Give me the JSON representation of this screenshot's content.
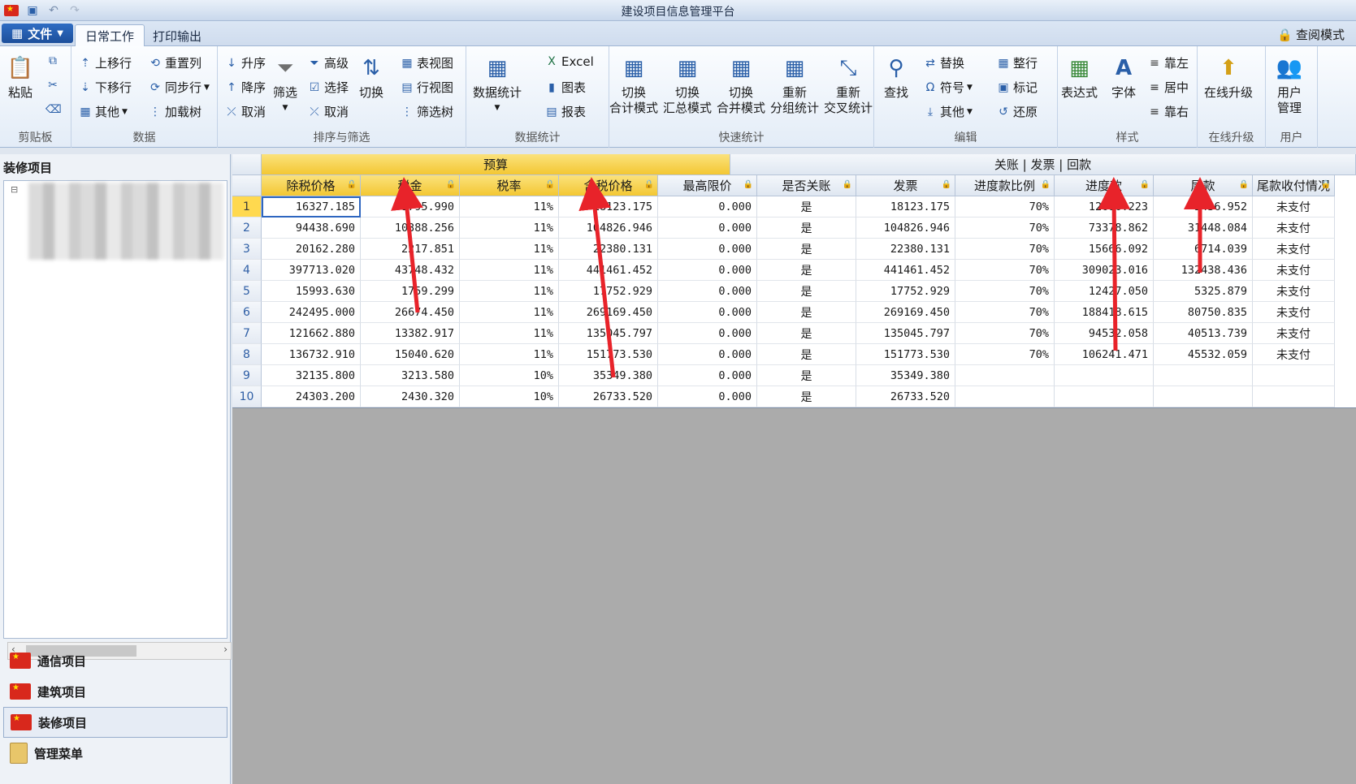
{
  "window": {
    "title": "建设项目信息管理平台",
    "view_mode": "查阅模式"
  },
  "tabs": {
    "file": "文件",
    "items": [
      "日常工作",
      "打印输出"
    ],
    "active": "日常工作"
  },
  "ribbon": {
    "clipboard": {
      "label": "剪贴板",
      "paste": "粘贴"
    },
    "data": {
      "label": "数据",
      "move_up": "上移行",
      "move_down": "下移行",
      "other": "其他",
      "reset_cols": "重置列",
      "sync_rows": "同步行",
      "load_tree": "加载树"
    },
    "sort_filter": {
      "label": "排序与筛选",
      "asc": "升序",
      "desc": "降序",
      "cancel_sort": "取消",
      "filter": "筛选",
      "advanced": "高级",
      "select": "选择",
      "cancel_filter": "取消",
      "switch": "切换",
      "table_view": "表视图",
      "row_view": "行视图",
      "filter_tree": "筛选树"
    },
    "stats": {
      "label": "数据统计",
      "data_stats": "数据统计",
      "excel": "Excel",
      "chart": "图表",
      "report": "报表"
    },
    "quick_stats": {
      "label": "快速统计",
      "b1_line1": "切换",
      "b1_line2": "合计模式",
      "b2_line1": "切换",
      "b2_line2": "汇总模式",
      "b3_line1": "切换",
      "b3_line2": "合并模式",
      "b4_line1": "重新",
      "b4_line2": "分组统计",
      "b5_line1": "重新",
      "b5_line2": "交叉统计"
    },
    "edit": {
      "label": "编辑",
      "find": "查找",
      "replace": "替换",
      "symbol": "符号",
      "other": "其他",
      "tidy": "整行",
      "mark": "标记",
      "restore": "还原"
    },
    "style": {
      "label": "样式",
      "expression": "表达式",
      "font": "字体",
      "left": "靠左",
      "center": "居中",
      "right": "靠右"
    },
    "upgrade": {
      "label": "在线升级",
      "button": "在线升级"
    },
    "user": {
      "label": "用户",
      "line1": "用户",
      "line2": "管理"
    }
  },
  "left_panel": {
    "title": "装修项目",
    "nav": [
      "通信项目",
      "建筑项目",
      "装修项目",
      "管理菜单"
    ],
    "active_nav": "装修项目"
  },
  "grid": {
    "band_headers": [
      "预算",
      "关账 | 发票 | 回款"
    ],
    "columns": [
      "除税价格",
      "税金",
      "税率",
      "含税价格",
      "最高限价",
      "是否关账",
      "发票",
      "进度款比例",
      "进度款",
      "尾款",
      "尾款收付情况"
    ],
    "rows": [
      [
        "16327.185",
        "1795.990",
        "11%",
        "18123.175",
        "0.000",
        "是",
        "18123.175",
        "70%",
        "12686.223",
        "5436.952",
        "未支付"
      ],
      [
        "94438.690",
        "10388.256",
        "11%",
        "104826.946",
        "0.000",
        "是",
        "104826.946",
        "70%",
        "73378.862",
        "31448.084",
        "未支付"
      ],
      [
        "20162.280",
        "2217.851",
        "11%",
        "22380.131",
        "0.000",
        "是",
        "22380.131",
        "70%",
        "15666.092",
        "6714.039",
        "未支付"
      ],
      [
        "397713.020",
        "43748.432",
        "11%",
        "441461.452",
        "0.000",
        "是",
        "441461.452",
        "70%",
        "309023.016",
        "132438.436",
        "未支付"
      ],
      [
        "15993.630",
        "1759.299",
        "11%",
        "17752.929",
        "0.000",
        "是",
        "17752.929",
        "70%",
        "12427.050",
        "5325.879",
        "未支付"
      ],
      [
        "242495.000",
        "26674.450",
        "11%",
        "269169.450",
        "0.000",
        "是",
        "269169.450",
        "70%",
        "188418.615",
        "80750.835",
        "未支付"
      ],
      [
        "121662.880",
        "13382.917",
        "11%",
        "135045.797",
        "0.000",
        "是",
        "135045.797",
        "70%",
        "94532.058",
        "40513.739",
        "未支付"
      ],
      [
        "136732.910",
        "15040.620",
        "11%",
        "151773.530",
        "0.000",
        "是",
        "151773.530",
        "70%",
        "106241.471",
        "45532.059",
        "未支付"
      ],
      [
        "32135.800",
        "3213.580",
        "10%",
        "35349.380",
        "0.000",
        "是",
        "35349.380",
        "",
        "",
        "",
        ""
      ],
      [
        "24303.200",
        "2430.320",
        "10%",
        "26733.520",
        "0.000",
        "是",
        "26733.520",
        "",
        "",
        "",
        ""
      ]
    ],
    "selected_row": 1
  },
  "colors": {
    "accent_gold": "#f3c733",
    "arrow_red": "#e8232a",
    "file_blue": "#1d4f9b"
  }
}
